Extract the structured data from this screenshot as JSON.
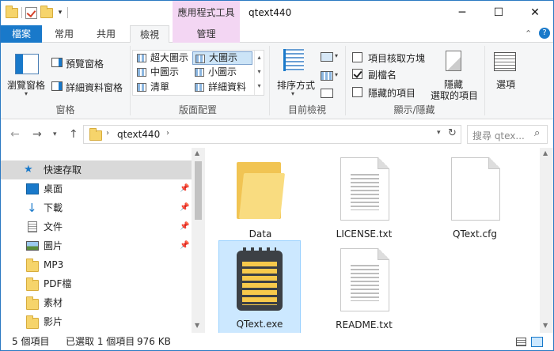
{
  "window": {
    "title": "qtext440",
    "contextual_tool_tab": "應用程式工具",
    "controls": {
      "minimize": "─",
      "maximize": "☐",
      "close": "✕"
    }
  },
  "ribbon": {
    "tabs": [
      {
        "label": "檔案"
      },
      {
        "label": "常用"
      },
      {
        "label": "共用"
      },
      {
        "label": "檢視"
      },
      {
        "label": "管理"
      }
    ],
    "groups": {
      "panes": {
        "label": "窗格",
        "navigation_pane": "瀏覽窗格",
        "preview_pane": "預覽窗格",
        "details_pane": "詳細資料窗格"
      },
      "layout": {
        "label": "版面配置",
        "items": [
          "超大圖示",
          "大圖示",
          "中圖示",
          "小圖示",
          "清單",
          "詳細資料"
        ],
        "selected": "大圖示"
      },
      "current_view": {
        "label": "目前檢視",
        "sort_by": "排序方式"
      },
      "show_hide": {
        "label": "顯示/隱藏",
        "item_check_boxes": "項目核取方塊",
        "file_name_extensions": "副檔名",
        "hidden_items": "隱藏的項目",
        "hide_selected": "隱藏",
        "hide_selected_line2": "選取的項目"
      },
      "options": {
        "label": "選項"
      }
    },
    "checkboxes": {
      "item_check_boxes": false,
      "file_name_extensions": true,
      "hidden_items": false
    }
  },
  "address": {
    "path": "qtext440",
    "search_placeholder": "搜尋 qtex..."
  },
  "nav_pane": {
    "items": [
      {
        "label": "快速存取",
        "icon": "star-icon",
        "pinned": false
      },
      {
        "label": "桌面",
        "icon": "desktop-icon",
        "pinned": true
      },
      {
        "label": "下載",
        "icon": "download-icon",
        "pinned": true
      },
      {
        "label": "文件",
        "icon": "document-icon",
        "pinned": true
      },
      {
        "label": "圖片",
        "icon": "picture-icon",
        "pinned": true
      },
      {
        "label": "MP3",
        "icon": "folder-icon",
        "pinned": false
      },
      {
        "label": "PDF檔",
        "icon": "folder-icon",
        "pinned": false
      },
      {
        "label": "素材",
        "icon": "folder-icon",
        "pinned": false
      },
      {
        "label": "影片",
        "icon": "folder-icon",
        "pinned": false
      }
    ]
  },
  "files": [
    {
      "name": "Data",
      "type": "folder"
    },
    {
      "name": "LICENSE.txt",
      "type": "text"
    },
    {
      "name": "QText.cfg",
      "type": "config"
    },
    {
      "name": "QText.exe",
      "type": "app",
      "selected": true
    },
    {
      "name": "README.txt",
      "type": "text"
    }
  ],
  "status": {
    "item_count": "5 個項目",
    "selection": "已選取 1 個項目",
    "size": "976 KB"
  },
  "colors": {
    "accent": "#1979ca",
    "contextual_tab": "#f3d6f3",
    "selection": "#cce8ff",
    "folder": "#f6d46b",
    "notepad_yellow": "#f7c94b",
    "notepad_dark": "#3c4045"
  }
}
